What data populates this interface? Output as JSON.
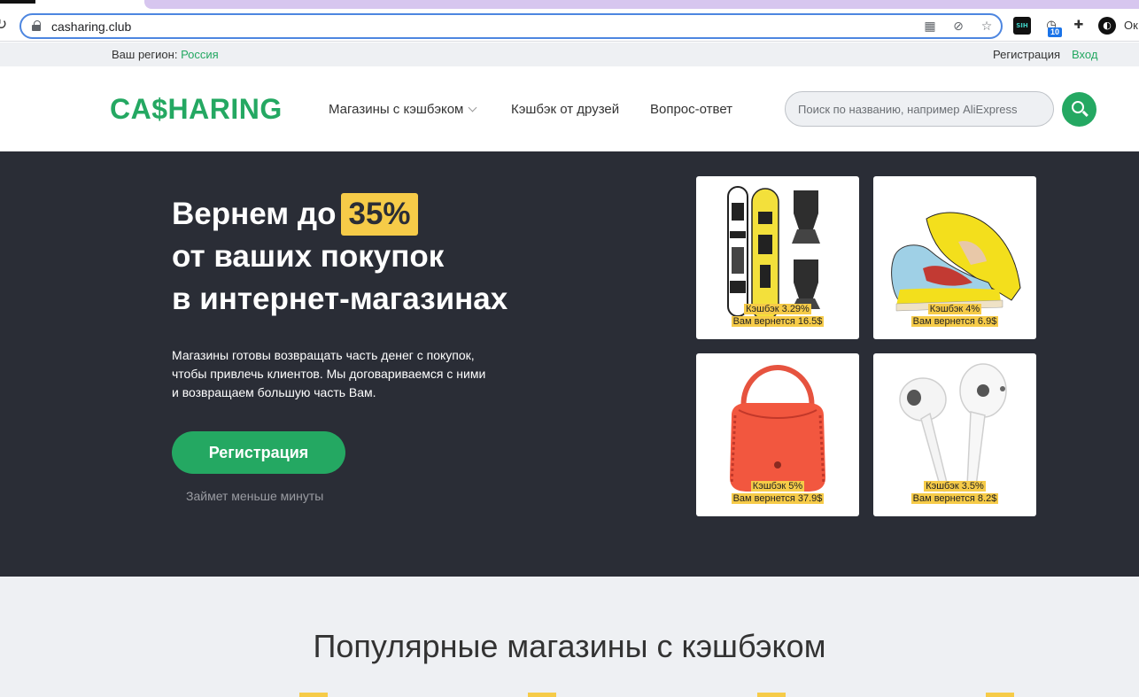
{
  "browser": {
    "url": "casharing.club",
    "ext_sih_label": "SIH",
    "ext_badge": "10",
    "profile_text": "Ок"
  },
  "topbar": {
    "region_label": "Ваш регион:",
    "region_value": "Россия",
    "register": "Регистрация",
    "login": "Вход"
  },
  "header": {
    "logo": "CA$HARING",
    "nav": [
      "Магазины с кэшбэком",
      "Кэшбэк от друзей",
      "Вопрос-ответ"
    ],
    "search_placeholder": "Поиск по названию, например AliExpress"
  },
  "hero": {
    "title_prefix": "Вернем до",
    "title_highlight": "35%",
    "title_line2": "от ваших покупок",
    "title_line3": "в интернет-магазинах",
    "description_line1": "Магазины готовы возвращать часть денег с покупок,",
    "description_line2": "чтобы привлечь клиентов. Мы договариваемся с ними",
    "description_line3": "и возвращаем большую часть Вам.",
    "cta": "Регистрация",
    "note": "Займет меньше минуты"
  },
  "products": [
    {
      "cashback": "Кэшбэк 3.29%",
      "returns": "Вам вернется 16.5$",
      "icon": "snowboard-image"
    },
    {
      "cashback": "Кэшбэк 4%",
      "returns": "Вам вернется 6.9$",
      "icon": "sneakers-image"
    },
    {
      "cashback": "Кэшбэк 5%",
      "returns": "Вам вернется 37.9$",
      "icon": "handbag-image"
    },
    {
      "cashback": "Кэшбэк 3.5%",
      "returns": "Вам вернется 8.2$",
      "icon": "earbuds-image"
    }
  ],
  "popular": {
    "title": "Популярные магазины с кэшбэком"
  },
  "colors": {
    "brand_green": "#24a862",
    "hero_bg": "#2a2d36",
    "highlight_yellow": "#f6cb48"
  }
}
